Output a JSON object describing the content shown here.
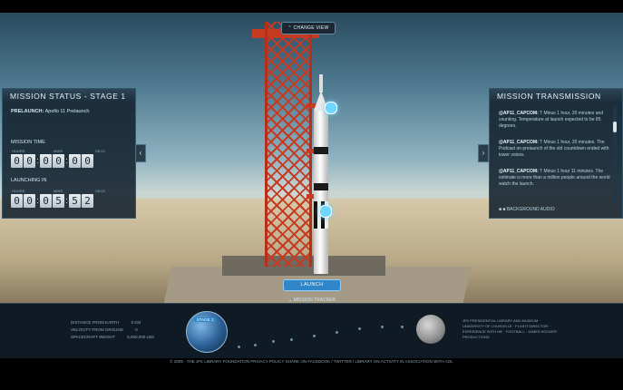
{
  "nav": {
    "change_view": "⌃ CHANGE VIEW"
  },
  "status_panel": {
    "title": "MISSION STATUS - STAGE 1",
    "prelaunch_label": "PRELAUNCH:",
    "prelaunch_value": "Apollo 11 Prelaunch",
    "mission_time_label": "MISSION TIME",
    "launching_in_label": "LAUNCHING IN",
    "unit_labels": [
      "HOURS",
      "MINS",
      "SECS"
    ],
    "mission_time": [
      "0",
      "0",
      "0",
      "0",
      "0",
      "0"
    ],
    "launching_in": [
      "0",
      "0",
      "0",
      "5",
      "5",
      "2"
    ]
  },
  "transmission_panel": {
    "title": "MISSION TRANSMISSION",
    "messages": [
      {
        "from": "@AP11_CAPCOM:",
        "text": "T Minus 1 hour, 20 minutes and counting. Temperature at launch expected to be 85 degrees."
      },
      {
        "from": "@AP11_CAPCOM:",
        "text": "T Minus 1 hour, 20 minutes. The Podcast on prelaunch of the old countdown ended with lower voices."
      },
      {
        "from": "@AP11_CAPCOM:",
        "text": "T Minus 1 hour 11 minutes. The estimate is more than a million people around the world watch the launch."
      }
    ],
    "footer": "BACKGROUND AUDIO"
  },
  "launch": {
    "label": "LAUNCH"
  },
  "mission_tracker": {
    "label": "⌄ MISSION TRACKER ⌄"
  },
  "bottom": {
    "stats": [
      {
        "label": "DISTANCE FROM EARTH",
        "value": "0 KM"
      },
      {
        "label": "VELOCITY FROM GROUND",
        "value": "0"
      },
      {
        "label": "SPACECRAFT WEIGHT",
        "value": "6,000,000 LBS"
      }
    ],
    "stage_label": "STAGE 1",
    "right_info": "JFK PRESIDENTIAL LIBRARY AND MUSEUM · UNIVERSITY OF LOUISVILLE · FLIGHT DIRECTOR · EXPERIENCE WITH ME · FOOTBALL · JAMES HOOVER PRODUCTIONS"
  },
  "footer": {
    "text": "© 2009 - THE JFK LIBRARY FOUNDATION    PRIVACY POLICY    SHARE ON FACEBOOK / TWITTER / LIBRARY ON ACTIVITY    IN ASSOCIATION WITH AOL"
  }
}
